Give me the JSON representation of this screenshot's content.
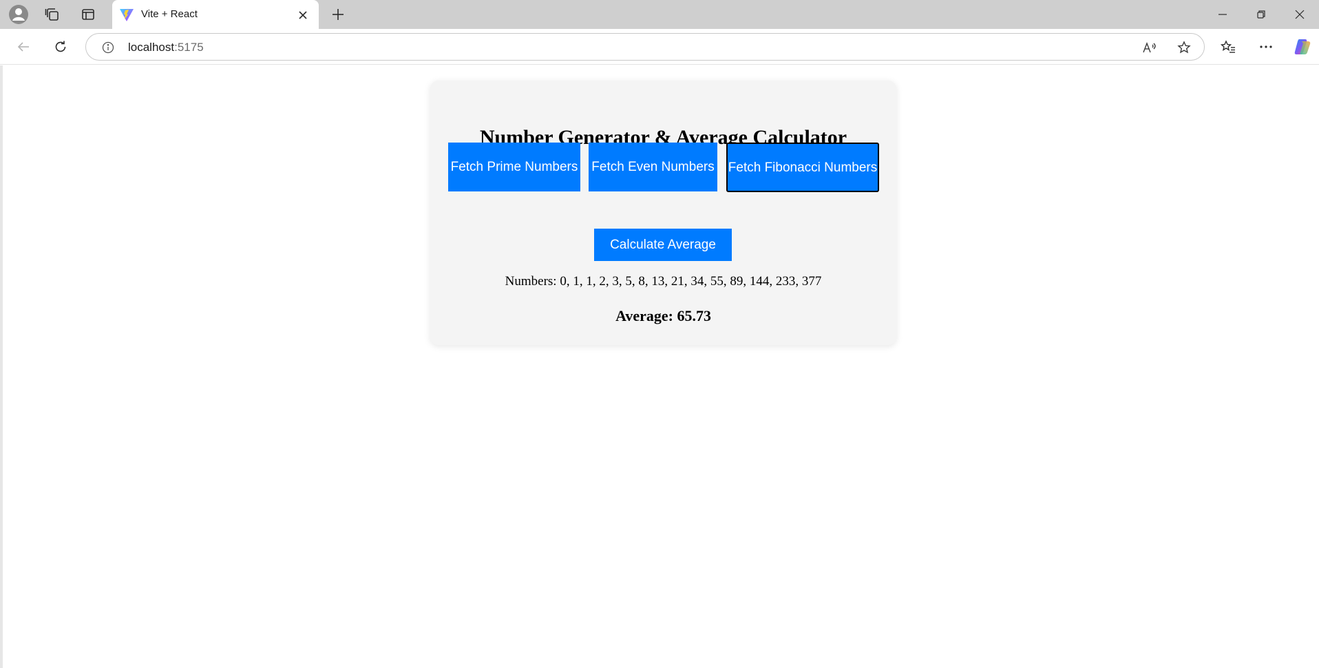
{
  "browser": {
    "tab": {
      "title": "Vite + React"
    },
    "address": {
      "host": "localhost",
      "port": ":5175"
    }
  },
  "page": {
    "title": "Number Generator & Average Calculator",
    "buttons": {
      "prime": "Fetch Prime Numbers",
      "even": "Fetch Even Numbers",
      "fibonacci": "Fetch Fibonacci Numbers",
      "average": "Calculate Average"
    },
    "numbers_text": "Numbers: 0, 1, 1, 2, 3, 5, 8, 13, 21, 34, 55, 89, 144, 233, 377",
    "average_text": "Average: 65.73"
  },
  "colors": {
    "button_bg": "#007bff",
    "card_bg": "#f4f4f4"
  }
}
